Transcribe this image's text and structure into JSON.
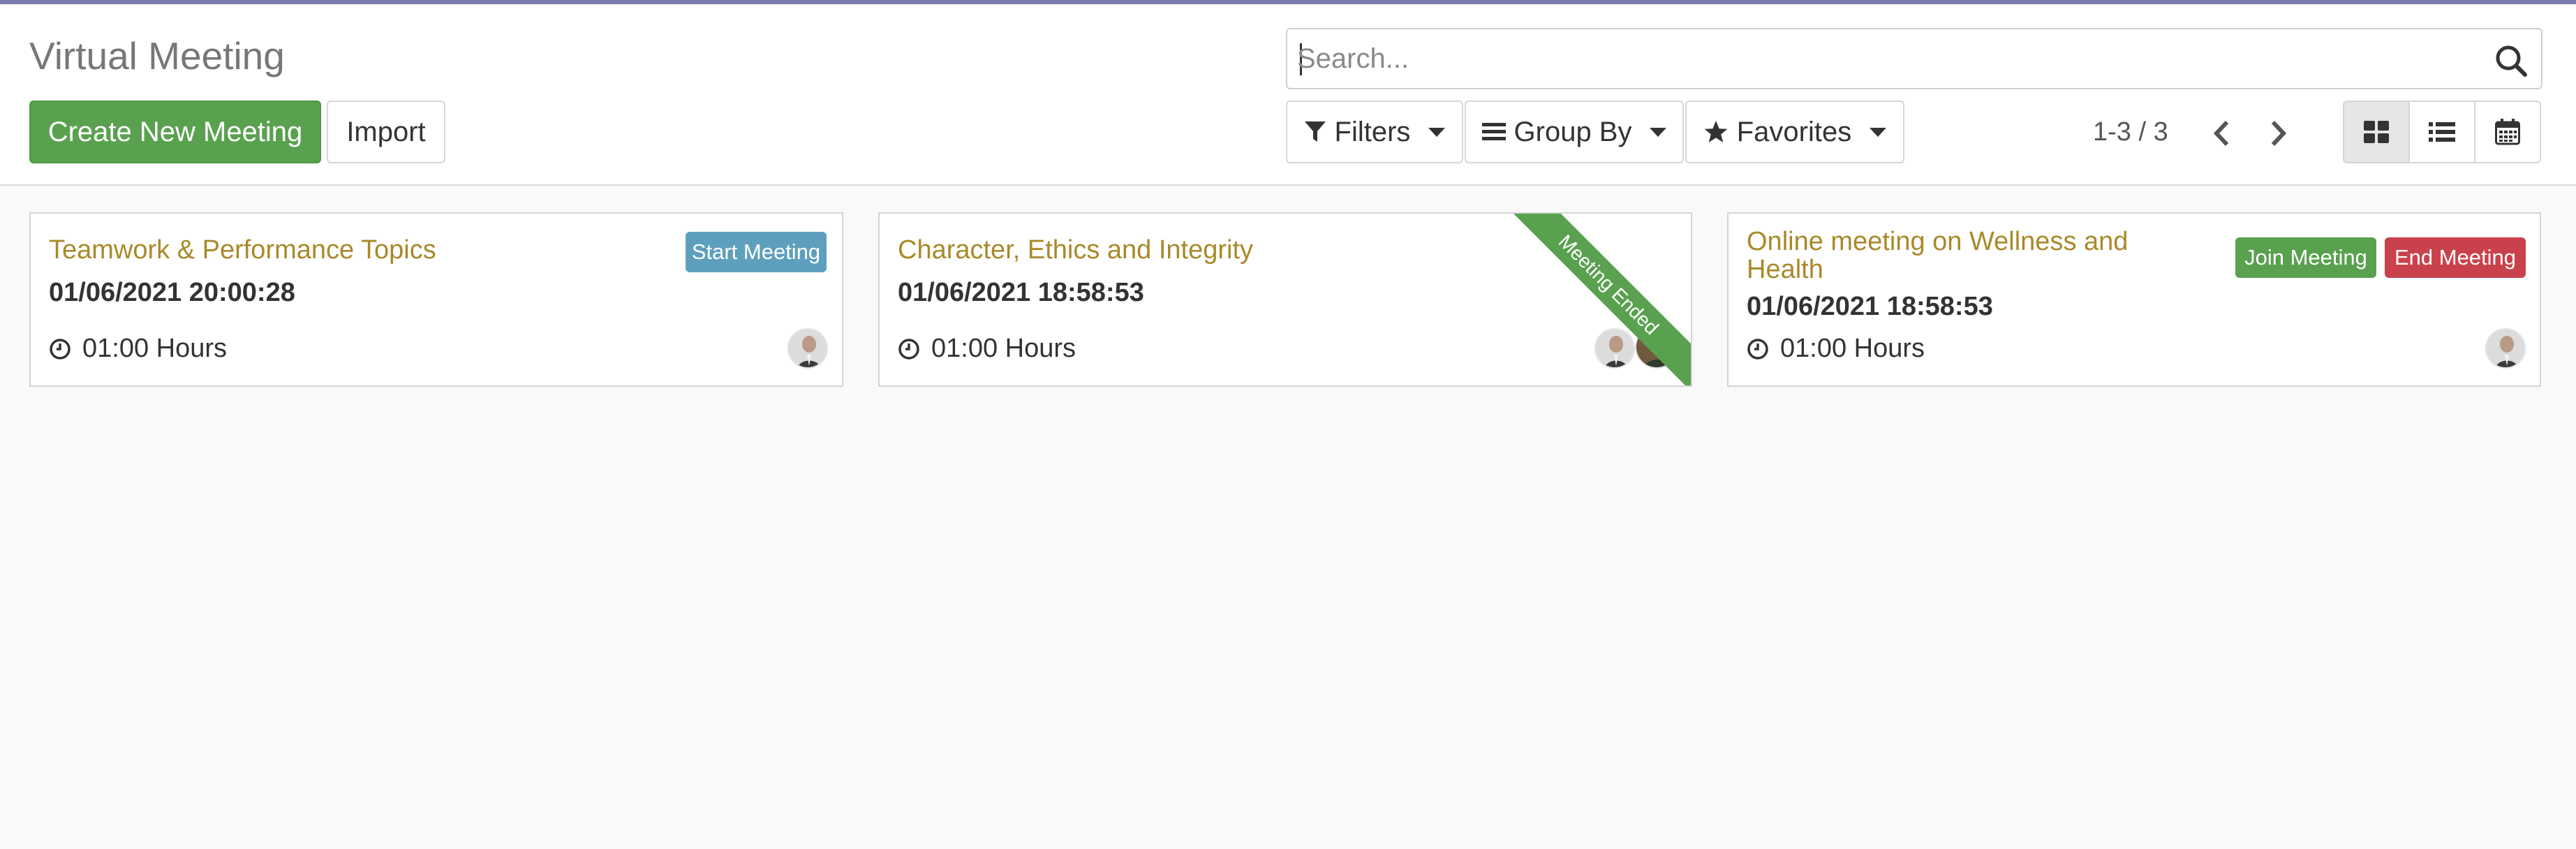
{
  "page": {
    "title": "Virtual Meeting"
  },
  "toolbar": {
    "create_label": "Create New Meeting",
    "import_label": "Import"
  },
  "search": {
    "placeholder": "Search..."
  },
  "filters": {
    "filters_label": "Filters",
    "group_by_label": "Group By",
    "favorites_label": "Favorites"
  },
  "pager": {
    "value": "1-3 / 3"
  },
  "views": [
    "kanban",
    "list",
    "calendar"
  ],
  "icons": {
    "search": "search-icon",
    "filter": "filter-icon",
    "group_by": "bars-icon",
    "favorites": "star-icon",
    "prev": "chevron-left-icon",
    "next": "chevron-right-icon",
    "clock": "clock-icon"
  },
  "colors": {
    "primary": "#59a14f",
    "card_title": "#a98929",
    "start_badge": "#5f9fbe",
    "join_badge": "#59a14f",
    "end_badge": "#c9424b",
    "topline": "#7c7bad"
  },
  "meetings": [
    {
      "title": "Teamwork & Performance Topics",
      "datetime": "01/06/2021 20:00:28",
      "duration": "01:00 Hours",
      "badges": [
        "Start Meeting"
      ],
      "attendees": 1
    },
    {
      "title": "Character, Ethics and Integrity",
      "datetime": "01/06/2021 18:58:53",
      "duration": "01:00 Hours",
      "ribbon": "Meeting Ended",
      "attendees": 2
    },
    {
      "title": "Online meeting on Wellness and Health",
      "datetime": "01/06/2021 18:58:53",
      "duration": "01:00 Hours",
      "badges": [
        "Join Meeting",
        "End Meeting"
      ],
      "attendees": 1
    }
  ]
}
